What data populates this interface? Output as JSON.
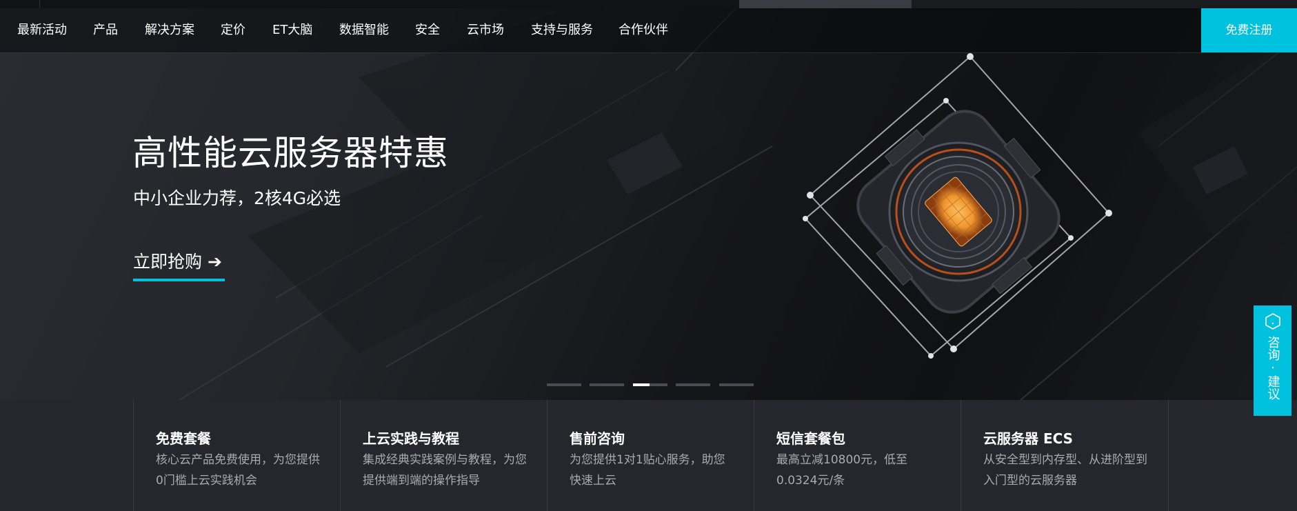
{
  "nav": {
    "items": [
      "最新活动",
      "产品",
      "解决方案",
      "定价",
      "ET大脑",
      "数据智能",
      "安全",
      "云市场",
      "支持与服务",
      "合作伙伴"
    ],
    "signup": "免费注册"
  },
  "hero": {
    "title": "高性能云服务器特惠",
    "subtitle": "中小企业力荐，2核4G必选",
    "cta": "立即抢购",
    "cta_arrow": "➔",
    "slides": 5,
    "active_slide": 3
  },
  "features": [
    {
      "title": "免费套餐",
      "desc": "核心云产品免费使用，为您提供0门槛上云实践机会"
    },
    {
      "title": "上云实践与教程",
      "desc": "集成经典实践案例与教程，为您提供端到端的操作指导"
    },
    {
      "title": "售前咨询",
      "desc": "为您提供1对1贴心服务，助您快速上云"
    },
    {
      "title": "短信套餐包",
      "desc": "最高立减10800元，低至0.0324元/条"
    },
    {
      "title": "云服务器 ECS",
      "desc": "从安全型到内存型、从进阶型到入门型的云服务器"
    }
  ],
  "consult": {
    "label": "咨询·建议",
    "icon": "hexagon-chat-icon"
  },
  "colors": {
    "accent": "#00c1de",
    "hero_bg": "#1c1e22",
    "cards_bg": "#25272d",
    "chip_glow": "#f0962e"
  }
}
